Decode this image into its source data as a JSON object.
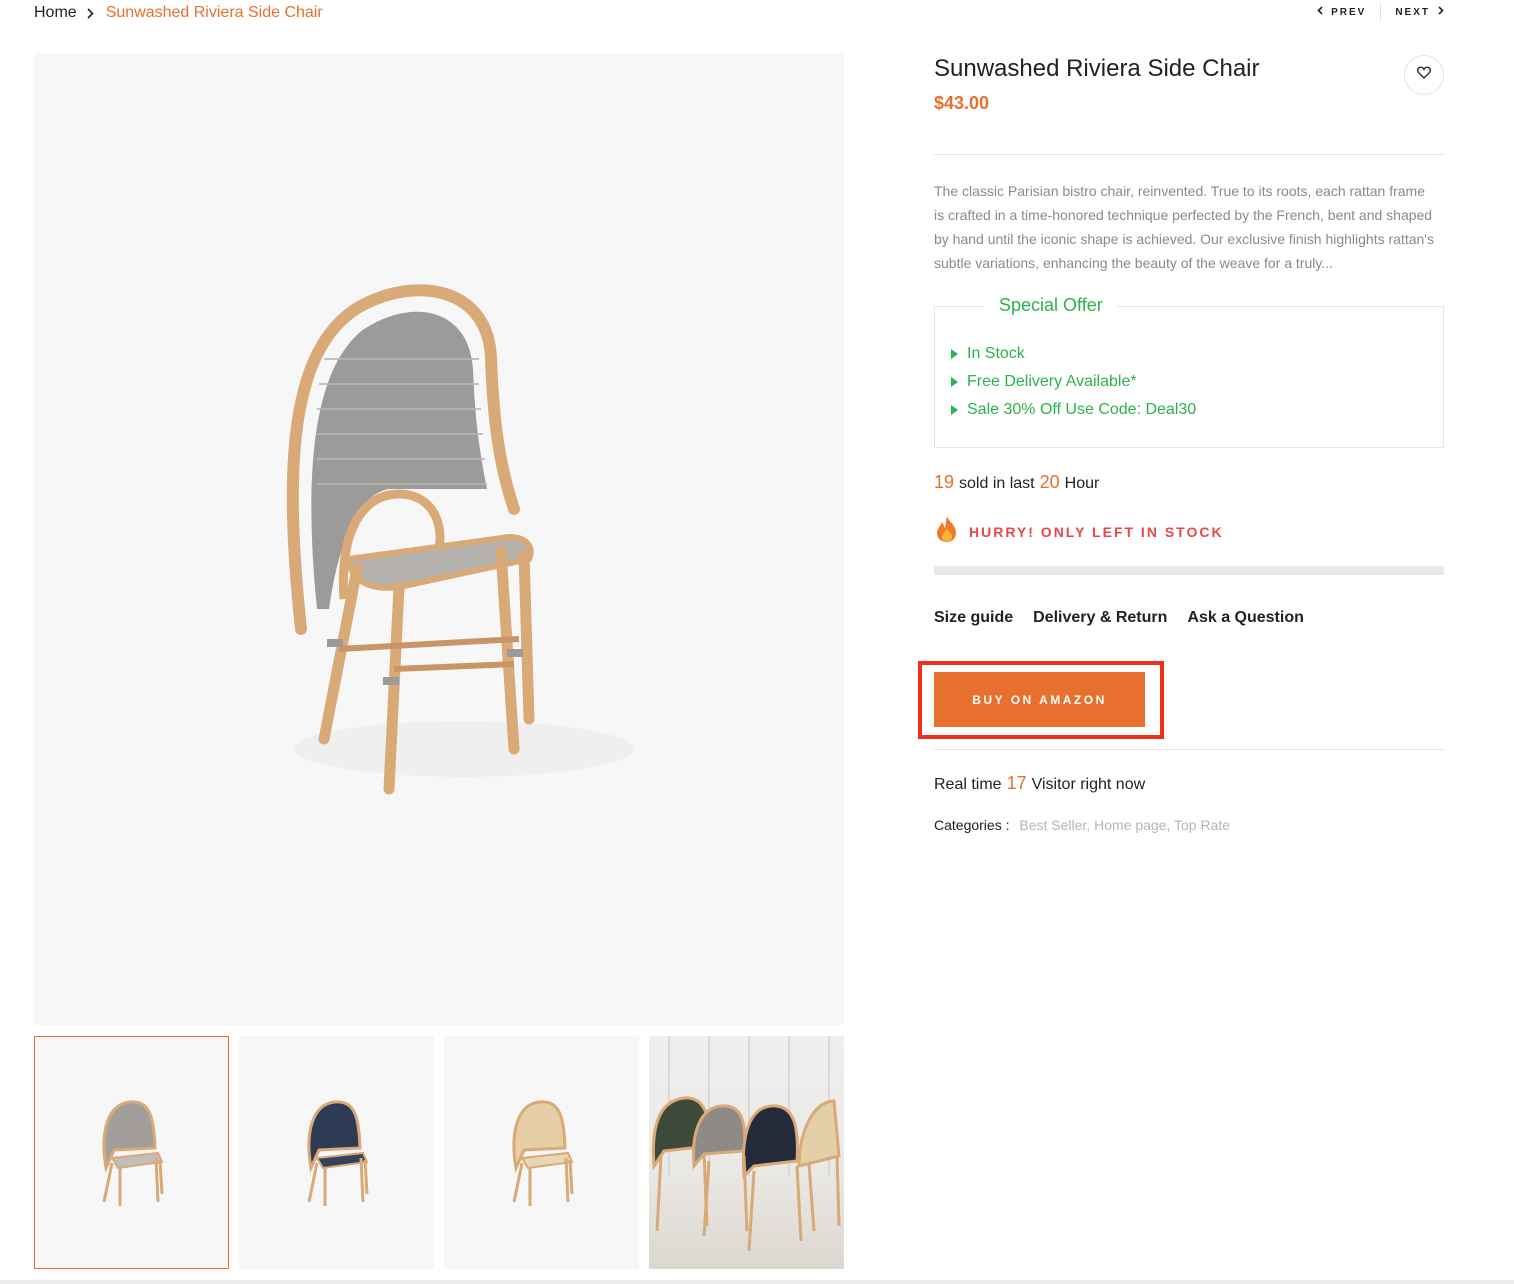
{
  "breadcrumb": {
    "home": "Home",
    "current": "Sunwashed Riviera Side Chair"
  },
  "nav": {
    "prev": "PREV",
    "next": "NEXT"
  },
  "gallery": {
    "main_image": "rattan-chair-gray-weave",
    "thumbnails": [
      {
        "name": "gray-weave-chair",
        "active": true
      },
      {
        "name": "navy-weave-chair",
        "active": false
      },
      {
        "name": "natural-weave-chair",
        "active": false
      },
      {
        "name": "chairs-group-scene",
        "active": false
      }
    ]
  },
  "product": {
    "title": "Sunwashed Riviera Side Chair",
    "price": "$43.00",
    "description": "The classic Parisian bistro chair, reinvented. True to its roots, each rattan frame is crafted in a time-honored technique perfected by the French, bent and shaped by hand until the iconic shape is achieved. Our exclusive finish highlights rattan's subtle variations, enhancing the beauty of the weave for a truly..."
  },
  "offer": {
    "title": "Special Offer",
    "items": [
      "In Stock",
      "Free Delivery Available*",
      "Sale 30% Off Use Code: Deal30"
    ]
  },
  "sold": {
    "count": "19",
    "text1": "sold in last",
    "hours": "20",
    "text2": "Hour"
  },
  "hurry": {
    "text": "HURRY! ONLY LEFT IN STOCK",
    "stock_fraction": 0
  },
  "links": {
    "size_guide": "Size guide",
    "delivery": "Delivery & Return",
    "ask": "Ask a Question"
  },
  "buy_button": "BUY ON AMAZON",
  "realtime": {
    "prefix": "Real time",
    "count": "17",
    "suffix": "Visitor right now"
  },
  "categories": {
    "label": "Categories :",
    "values": "Best Seller, Home page, Top Rate"
  },
  "colors": {
    "accent": "#e8702e",
    "offer_green": "#2bb24c",
    "hurry_red": "#e8474a",
    "highlight_red": "#f0301c"
  }
}
